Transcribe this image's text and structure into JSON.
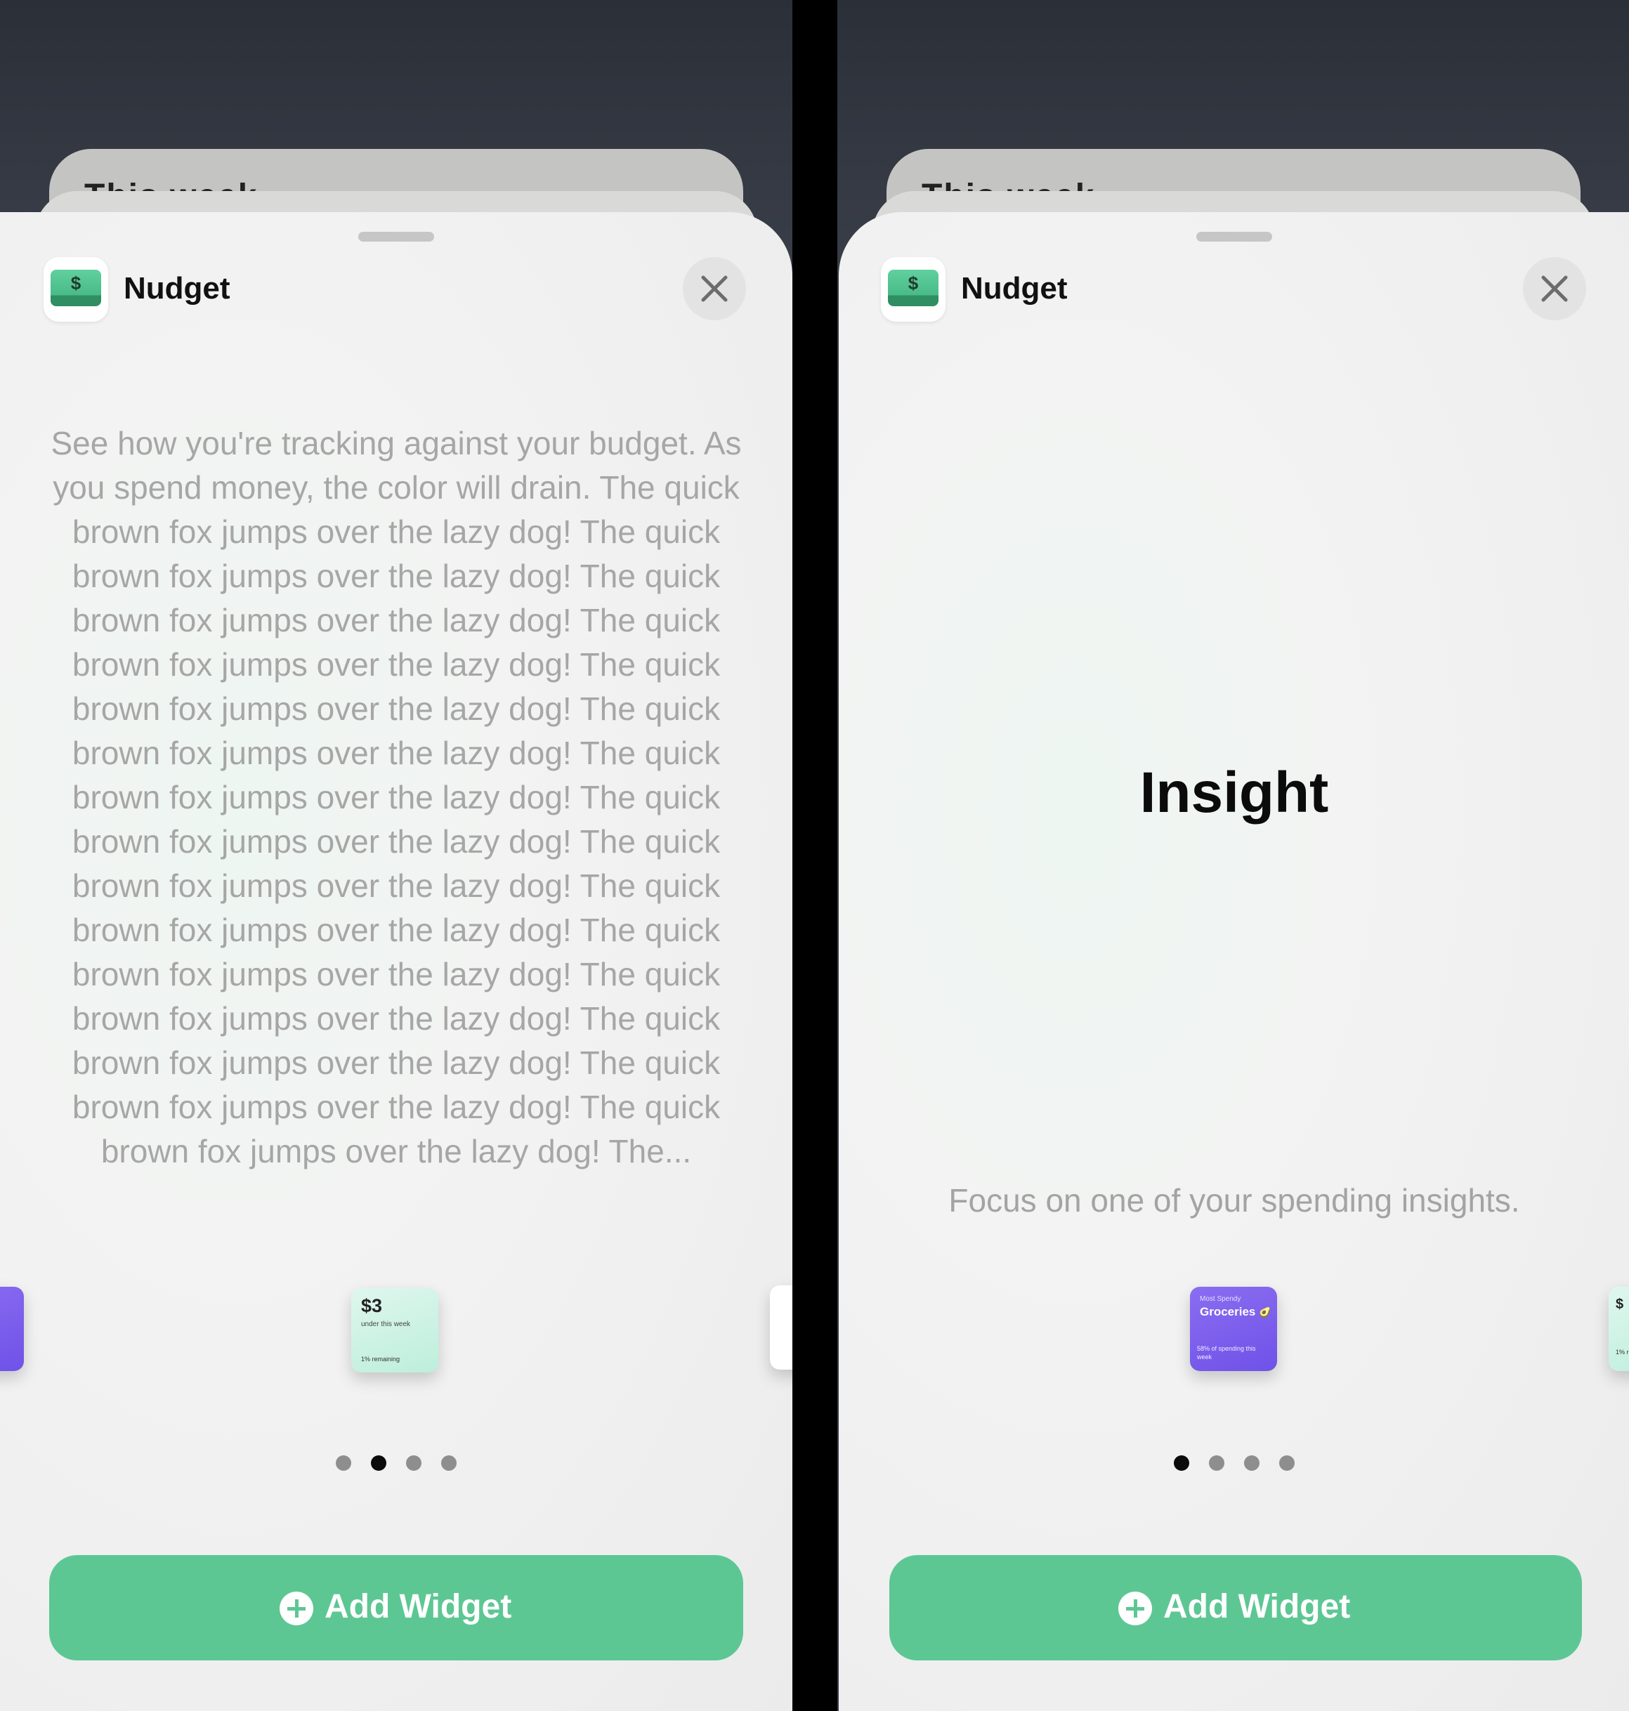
{
  "left": {
    "ghost_text": "This week",
    "app_name": "Nudget",
    "bill_symbol": "$",
    "description": "See how you're tracking against your budget. As you spend money, the color will drain. The quick brown fox jumps over the lazy dog! The quick brown fox jumps over the lazy dog! The quick brown fox jumps over the lazy dog! The quick brown fox jumps over the lazy dog! The quick brown fox jumps over the lazy dog! The quick brown fox jumps over the lazy dog! The quick brown fox jumps over the lazy dog! The quick brown fox jumps over the lazy dog! The quick brown fox jumps over the lazy dog! The quick brown fox jumps over the lazy dog! The quick brown fox jumps over the lazy dog! The quick brown fox jumps over the lazy dog! The quick brown fox jumps over the lazy dog! The quick brown fox jumps over the lazy dog! The quick brown fox jumps over the lazy dog! The...",
    "widget": {
      "amount": "$3",
      "subtitle": "under this week",
      "footer": "1% remaining"
    },
    "pages": 4,
    "active_page": 2,
    "button_label": "Add Widget"
  },
  "right": {
    "ghost_text": "This week",
    "app_name": "Nudget",
    "bill_symbol": "$",
    "title": "Insight",
    "description": "Focus on one of your spending insights.",
    "widget": {
      "label": "Most Spendy",
      "category": "Groceries",
      "emoji": "🥑",
      "footer": "58% of spending this week"
    },
    "peek_widget": {
      "amount": "$",
      "footer": "1% r"
    },
    "pages": 4,
    "active_page": 1,
    "button_label": "Add Widget"
  },
  "colors": {
    "accent": "#5dc794",
    "widget_purple": "#7a5cf0",
    "widget_mint": "#c8f1e2"
  },
  "icons": {
    "close": "close-icon",
    "add": "plus-circle-icon",
    "app": "dollar-bill-icon"
  }
}
